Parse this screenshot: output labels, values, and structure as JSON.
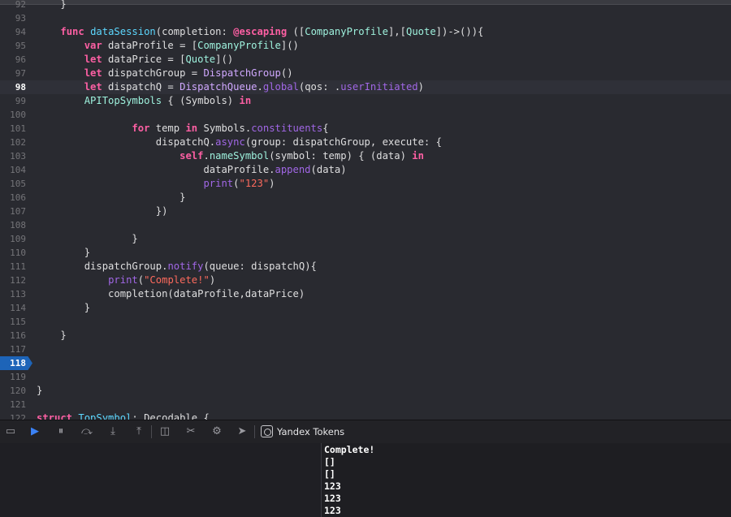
{
  "editor": {
    "lines": [
      {
        "n": "92",
        "segs": [
          {
            "t": "    }",
            "c": ""
          }
        ]
      },
      {
        "n": "93",
        "segs": []
      },
      {
        "n": "94",
        "segs": [
          {
            "t": "    ",
            "c": ""
          },
          {
            "t": "func",
            "c": "kw"
          },
          {
            "t": " ",
            "c": ""
          },
          {
            "t": "dataSession",
            "c": "ty"
          },
          {
            "t": "(completion: ",
            "c": ""
          },
          {
            "t": "@escaping",
            "c": "kw"
          },
          {
            "t": " ([",
            "c": ""
          },
          {
            "t": "CompanyProfile",
            "c": "tp"
          },
          {
            "t": "],[",
            "c": ""
          },
          {
            "t": "Quote",
            "c": "tp"
          },
          {
            "t": "])->()){",
            "c": ""
          }
        ]
      },
      {
        "n": "95",
        "segs": [
          {
            "t": "        ",
            "c": ""
          },
          {
            "t": "var",
            "c": "kw"
          },
          {
            "t": " dataProfile = [",
            "c": ""
          },
          {
            "t": "CompanyProfile",
            "c": "tp"
          },
          {
            "t": "]()",
            "c": ""
          }
        ]
      },
      {
        "n": "96",
        "segs": [
          {
            "t": "        ",
            "c": ""
          },
          {
            "t": "let",
            "c": "kw"
          },
          {
            "t": " dataPrice = [",
            "c": ""
          },
          {
            "t": "Quote",
            "c": "tp"
          },
          {
            "t": "]()",
            "c": ""
          }
        ]
      },
      {
        "n": "97",
        "segs": [
          {
            "t": "        ",
            "c": ""
          },
          {
            "t": "let",
            "c": "kw"
          },
          {
            "t": " dispatchGroup = ",
            "c": ""
          },
          {
            "t": "DispatchGroup",
            "c": "ty2"
          },
          {
            "t": "()",
            "c": ""
          }
        ]
      },
      {
        "n": "98",
        "current": true,
        "segs": [
          {
            "t": "        ",
            "c": ""
          },
          {
            "t": "let",
            "c": "kw"
          },
          {
            "t": " dispatchQ = ",
            "c": ""
          },
          {
            "t": "DispatchQueue",
            "c": "ty2"
          },
          {
            "t": ".",
            "c": ""
          },
          {
            "t": "global",
            "c": "pr"
          },
          {
            "t": "(qos: .",
            "c": ""
          },
          {
            "t": "userInitiated",
            "c": "pr"
          },
          {
            "t": ")",
            "c": ""
          }
        ]
      },
      {
        "n": "99",
        "segs": [
          {
            "t": "        ",
            "c": ""
          },
          {
            "t": "APITopSymbols",
            "c": "tp"
          },
          {
            "t": " { (Symbols) ",
            "c": ""
          },
          {
            "t": "in",
            "c": "kw"
          }
        ]
      },
      {
        "n": "100",
        "segs": []
      },
      {
        "n": "101",
        "segs": [
          {
            "t": "                ",
            "c": ""
          },
          {
            "t": "for",
            "c": "kw"
          },
          {
            "t": " temp ",
            "c": ""
          },
          {
            "t": "in",
            "c": "kw"
          },
          {
            "t": " Symbols.",
            "c": ""
          },
          {
            "t": "constituents",
            "c": "pr"
          },
          {
            "t": "{",
            "c": ""
          }
        ]
      },
      {
        "n": "102",
        "segs": [
          {
            "t": "                    dispatchQ.",
            "c": ""
          },
          {
            "t": "async",
            "c": "pr"
          },
          {
            "t": "(group: dispatchGroup, execute: {",
            "c": ""
          }
        ]
      },
      {
        "n": "103",
        "segs": [
          {
            "t": "                        ",
            "c": ""
          },
          {
            "t": "self",
            "c": "kw"
          },
          {
            "t": ".",
            "c": ""
          },
          {
            "t": "nameSymbol",
            "c": "tp"
          },
          {
            "t": "(symbol: temp) { (data) ",
            "c": ""
          },
          {
            "t": "in",
            "c": "kw"
          }
        ]
      },
      {
        "n": "104",
        "segs": [
          {
            "t": "                            dataProfile.",
            "c": ""
          },
          {
            "t": "append",
            "c": "pr"
          },
          {
            "t": "(data)",
            "c": ""
          }
        ]
      },
      {
        "n": "105",
        "segs": [
          {
            "t": "                            ",
            "c": ""
          },
          {
            "t": "print",
            "c": "pr"
          },
          {
            "t": "(",
            "c": ""
          },
          {
            "t": "\"123\"",
            "c": "st"
          },
          {
            "t": ")",
            "c": ""
          }
        ]
      },
      {
        "n": "106",
        "segs": [
          {
            "t": "                        }",
            "c": ""
          }
        ]
      },
      {
        "n": "107",
        "segs": [
          {
            "t": "                    })",
            "c": ""
          }
        ]
      },
      {
        "n": "108",
        "segs": []
      },
      {
        "n": "109",
        "segs": [
          {
            "t": "                }",
            "c": ""
          }
        ]
      },
      {
        "n": "110",
        "segs": [
          {
            "t": "        }",
            "c": ""
          }
        ]
      },
      {
        "n": "111",
        "segs": [
          {
            "t": "        dispatchGroup.",
            "c": ""
          },
          {
            "t": "notify",
            "c": "pr"
          },
          {
            "t": "(queue: dispatchQ){",
            "c": ""
          }
        ]
      },
      {
        "n": "112",
        "segs": [
          {
            "t": "            ",
            "c": ""
          },
          {
            "t": "print",
            "c": "pr"
          },
          {
            "t": "(",
            "c": ""
          },
          {
            "t": "\"Complete!\"",
            "c": "st"
          },
          {
            "t": ")",
            "c": ""
          }
        ]
      },
      {
        "n": "113",
        "segs": [
          {
            "t": "            completion(dataProfile,dataPrice)",
            "c": ""
          }
        ]
      },
      {
        "n": "114",
        "segs": [
          {
            "t": "        }",
            "c": ""
          }
        ]
      },
      {
        "n": "115",
        "segs": []
      },
      {
        "n": "116",
        "segs": [
          {
            "t": "    }",
            "c": ""
          }
        ]
      },
      {
        "n": "117",
        "segs": []
      },
      {
        "n": "118",
        "breakpoint": true,
        "segs": []
      },
      {
        "n": "119",
        "segs": []
      },
      {
        "n": "120",
        "segs": [
          {
            "t": "}",
            "c": ""
          }
        ]
      },
      {
        "n": "121",
        "segs": []
      },
      {
        "n": "122",
        "segs": [
          {
            "t": "struct",
            "c": "kw"
          },
          {
            "t": " ",
            "c": ""
          },
          {
            "t": "TopSymbol",
            "c": "ty"
          },
          {
            "t": ": Decodable {",
            "c": ""
          }
        ]
      }
    ]
  },
  "debugbar": {
    "buttons": [
      {
        "name": "hide-debug-area-button",
        "icon": "panel-icon",
        "glyph": "▭",
        "color": ""
      },
      {
        "name": "breakpoints-toggle-button",
        "icon": "breakpoint-icon",
        "glyph": "▶",
        "color": "blue"
      },
      {
        "name": "pause-button",
        "icon": "pause-icon",
        "glyph": "⏸",
        "color": ""
      },
      {
        "name": "step-over-button",
        "icon": "step-over-icon",
        "glyph": "⤼",
        "color": ""
      },
      {
        "name": "step-into-button",
        "icon": "step-into-icon",
        "glyph": "⤓",
        "color": ""
      },
      {
        "name": "step-out-button",
        "icon": "step-out-icon",
        "glyph": "⤒",
        "color": ""
      },
      {
        "name": "view-hierarchy-button",
        "icon": "view-hierarchy-icon",
        "glyph": "◫",
        "color": ""
      },
      {
        "name": "memory-graph-button",
        "icon": "memory-graph-icon",
        "glyph": "✂",
        "color": ""
      },
      {
        "name": "environment-overrides-button",
        "icon": "environment-icon",
        "glyph": "⚙",
        "color": ""
      },
      {
        "name": "simulate-location-button",
        "icon": "location-arrow-icon",
        "glyph": "➤",
        "color": ""
      }
    ],
    "app_name": "Yandex Tokens"
  },
  "console": {
    "lines": [
      "Complete!",
      "[]",
      "[]",
      "123",
      "123",
      "123"
    ]
  }
}
